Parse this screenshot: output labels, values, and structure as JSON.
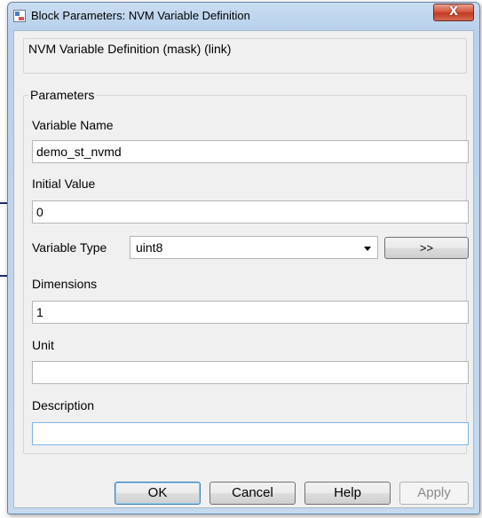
{
  "window": {
    "title": "Block Parameters: NVM Variable Definition",
    "close_label": "X"
  },
  "header": {
    "title": "NVM Variable Definition (mask) (link)"
  },
  "parameters": {
    "group_label": "Parameters",
    "variable_name": {
      "label": "Variable Name",
      "value": "demo_st_nvmd"
    },
    "initial_value": {
      "label": "Initial Value",
      "value": "0"
    },
    "variable_type": {
      "label": "Variable Type",
      "selected": "uint8",
      "expand_label": ">>"
    },
    "dimensions": {
      "label": "Dimensions",
      "value": "1"
    },
    "unit": {
      "label": "Unit",
      "value": ""
    },
    "description": {
      "label": "Description",
      "value": ""
    }
  },
  "buttons": {
    "ok": "OK",
    "cancel": "Cancel",
    "help": "Help",
    "apply": "Apply"
  }
}
